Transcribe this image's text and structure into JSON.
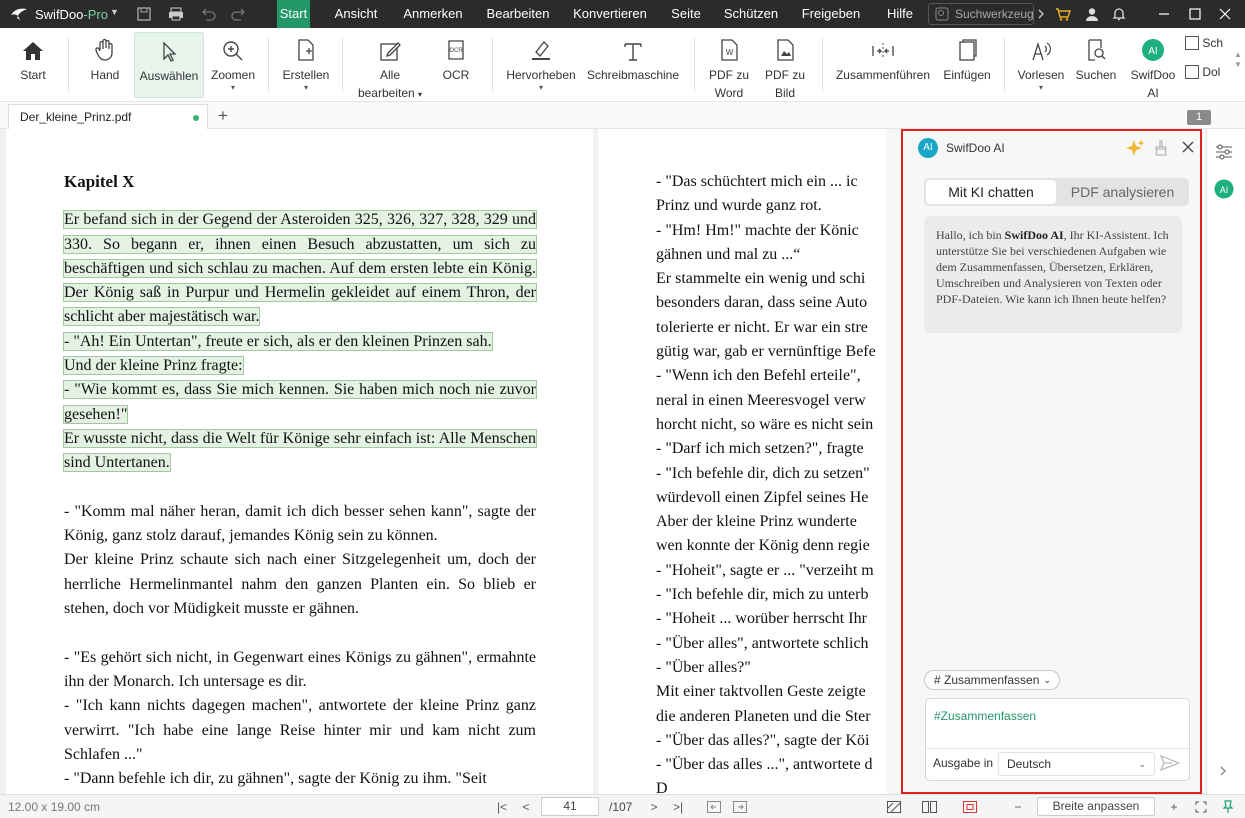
{
  "app": {
    "name_main": "SwifDoo",
    "name_suffix": "-Pro",
    "menus": [
      "Start",
      "Ansicht",
      "Anmerken",
      "Bearbeiten",
      "Konvertieren",
      "Seite",
      "Schützen",
      "Freigeben",
      "Hilfe"
    ],
    "active_menu": "Start",
    "search_placeholder": "Suchwerkzeug",
    "accent": "#229768"
  },
  "ribbon": {
    "start": "Start",
    "hand": "Hand",
    "select": "Auswählen",
    "zoom": "Zoomen",
    "create": "Erstellen",
    "edit_all_1": "Alle",
    "edit_all_2": "bearbeiten",
    "ocr": "OCR",
    "highlight": "Hervorheben",
    "typewriter": "Schreibmaschine",
    "pdf_word_1": "PDF zu",
    "pdf_word_2": "Word",
    "pdf_image_1": "PDF zu",
    "pdf_image_2": "Bild",
    "merge": "Zusammenführen",
    "insert": "Einfügen",
    "read": "Vorlesen",
    "search": "Suchen",
    "ai_1": "SwifDoo",
    "ai_2": "AI",
    "extra_1": "Sch",
    "extra_2": "Dol"
  },
  "tabs": {
    "doc_name": "Der_kleine_Prinz.pdf",
    "page_badge": "1"
  },
  "page_left": {
    "heading": "Kapitel X",
    "highlighted": [
      "Er befand sich in der Gegend der Asteroiden 325, 326, 327, 328, 329 und 330. So begann er, ihnen einen Besuch abzustatten, um sich zu beschäftigen und sich schlau zu machen. Auf dem ersten lebte ein König. Der König saß in  Purpur und Hermelin gekleidet auf einem Thron, der schlicht aber majestätisch war.",
      "- \"Ah! Ein Untertan\", freute er sich, als er den kleinen Prinzen sah.",
      "Und der kleine Prinz fragte:",
      "- \"Wie kommt es, dass Sie mich kennen. Sie haben mich noch nie zuvor gesehen!\"",
      "Er wusste nicht, dass die Welt für Könige sehr einfach ist: Alle Menschen sind Untertanen."
    ],
    "para1": "- \"Komm mal näher heran, damit ich dich besser sehen kann\", sagte der König, ganz stolz darauf, jemandes König sein zu können.",
    "para2": "Der kleine Prinz schaute sich nach einer Sitzgelegenheit um, doch der herrliche Hermelinmantel nahm den ganzen Planten ein. So blieb er stehen, doch vor Müdigkeit musste er gähnen.",
    "para3": "- \"Es gehört sich nicht, in Gegenwart eines Königs zu gähnen\", ermahnte ihn der Monarch. Ich untersage es dir.",
    "para4": "- \"Ich kann nichts dagegen machen\", antwortete der kleine Prinz ganz verwirrt. \"Ich habe eine lange Reise hinter mir und kam nicht zum Schlafen ...\"",
    "para5": "- \"Dann befehle ich dir, zu gähnen\", sagte der König zu ihm. \"Seit"
  },
  "page_right": {
    "lines": [
      "- \"Das schüchtert mich ein ... ic",
      "Prinz und wurde ganz rot.",
      "- \"Hm! Hm!\" machte der Könic",
      "gähnen und mal zu ...“",
      "Er stammelte ein wenig und schi",
      "besonders daran, dass seine Auto",
      "tolerierte er nicht. Er war ein stre",
      "gütig war, gab er vernünftige Befe",
      "- \"Wenn ich den Befehl erteile\",",
      "neral in einen Meeresvogel verw",
      "horcht nicht, so wäre es nicht sein",
      "- \"Darf ich mich setzen?\", fragte",
      "- \"Ich befehle dir, dich zu setzen\"",
      "würdevoll einen Zipfel seines He",
      "Aber der kleine Prinz wunderte",
      "wen konnte der König denn regie",
      "- \"Hoheit\", sagte er ... \"verzeiht m",
      "- \"Ich befehle dir, mich zu unterb",
      "- \"Hoheit ... worüber herrscht Ihr",
      "- \"Über alles\", antwortete schlich",
      "- \"Über alles?\"",
      "Mit einer taktvollen Geste zeigte",
      "die anderen Planeten und die Ster",
      "- \"Über das alles?\", sagte der Köi",
      "- \"Über das alles ...\", antwortete d",
      "D"
    ]
  },
  "ai": {
    "title": "SwifDoo AI",
    "logo": "AI",
    "tab_chat": "Mit KI chatten",
    "tab_pdf": "PDF analysieren",
    "msg_pre": "Hallo, ich bin ",
    "msg_bold": "SwifDoo AI",
    "msg_post": ", Ihr KI-Assistent. Ich unterstütze Sie bei verschiedenen Aufgaben wie dem Zusammenfassen, Übersetzen, Erklären, Umschreiben und Analysieren von Texten oder PDF-Dateien. Wie kann ich Ihnen heute helfen?",
    "chip": "# Zusammenfassen",
    "input_value": "#Zusammenfassen",
    "output_label": "Ausgabe in",
    "language": "Deutsch"
  },
  "status": {
    "dimensions": "12.00 x 19.00 cm",
    "page": "41",
    "total": "/107",
    "fit": "Breite anpassen"
  }
}
